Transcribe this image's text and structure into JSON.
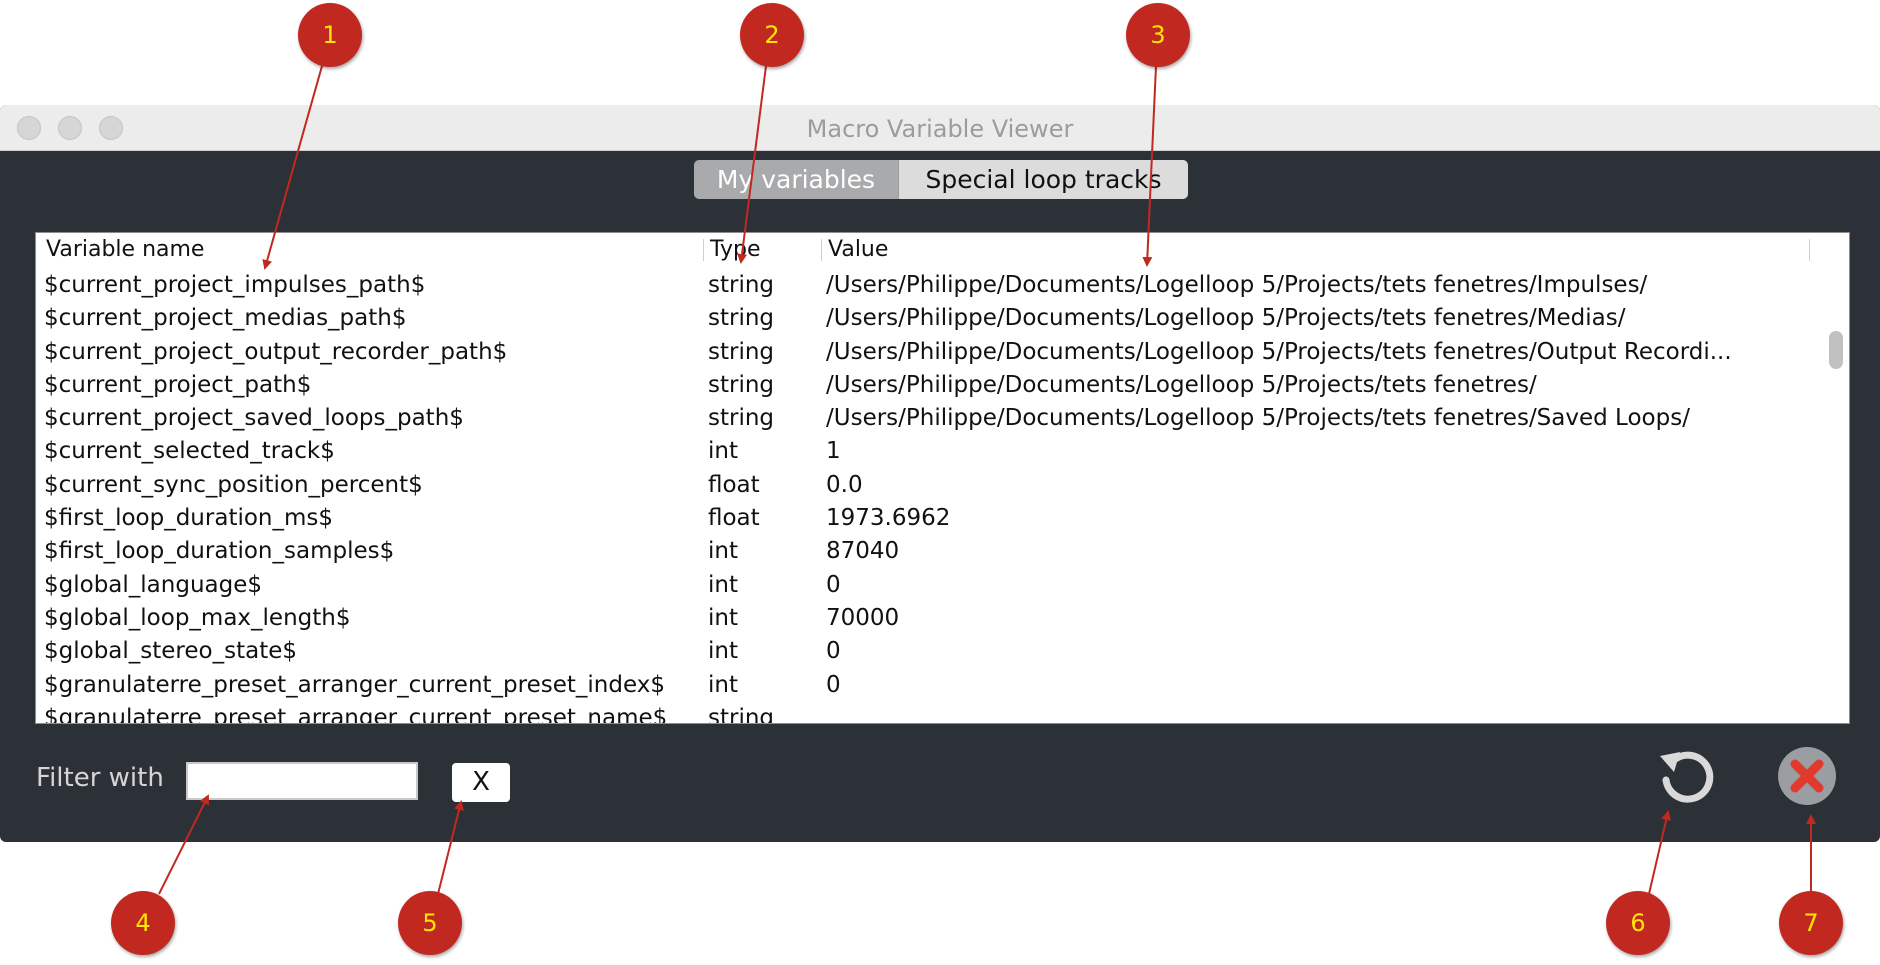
{
  "window": {
    "title": "Macro Variable Viewer",
    "controls": [
      "close",
      "minimize",
      "zoom"
    ]
  },
  "tabs": [
    {
      "label": "My variables",
      "active": true
    },
    {
      "label": "Special loop tracks",
      "active": false
    }
  ],
  "table": {
    "headers": {
      "name": "Variable name",
      "type": "Type",
      "value": "Value"
    },
    "rows": [
      {
        "name": "$current_project_impulses_path$",
        "type": "string",
        "value": "/Users/Philippe/Documents/Logelloop 5/Projects/tets fenetres/Impulses/"
      },
      {
        "name": "$current_project_medias_path$",
        "type": "string",
        "value": "/Users/Philippe/Documents/Logelloop 5/Projects/tets fenetres/Medias/"
      },
      {
        "name": "$current_project_output_recorder_path$",
        "type": "string",
        "value": "/Users/Philippe/Documents/Logelloop 5/Projects/tets fenetres/Output Recordi..."
      },
      {
        "name": "$current_project_path$",
        "type": "string",
        "value": "/Users/Philippe/Documents/Logelloop 5/Projects/tets fenetres/"
      },
      {
        "name": "$current_project_saved_loops_path$",
        "type": "string",
        "value": "/Users/Philippe/Documents/Logelloop 5/Projects/tets fenetres/Saved Loops/"
      },
      {
        "name": "$current_selected_track$",
        "type": "int",
        "value": "1"
      },
      {
        "name": "$current_sync_position_percent$",
        "type": "float",
        "value": "0.0"
      },
      {
        "name": "$first_loop_duration_ms$",
        "type": "float",
        "value": "1973.6962"
      },
      {
        "name": "$first_loop_duration_samples$",
        "type": "int",
        "value": "87040"
      },
      {
        "name": "$global_language$",
        "type": "int",
        "value": "0"
      },
      {
        "name": "$global_loop_max_length$",
        "type": "int",
        "value": "70000"
      },
      {
        "name": "$global_stereo_state$",
        "type": "int",
        "value": "0"
      },
      {
        "name": "$granulaterre_preset_arranger_current_preset_index$",
        "type": "int",
        "value": "0"
      },
      {
        "name": "$granulaterre_preset_arranger_current_preset_name$",
        "type": "string",
        "value": ""
      }
    ]
  },
  "filter": {
    "label": "Filter with",
    "value": "",
    "placeholder": "",
    "clear_label": "X"
  },
  "actions": {
    "refresh_icon": "refresh-icon",
    "close_icon": "close-x-icon"
  },
  "callouts": [
    "1",
    "2",
    "3",
    "4",
    "5",
    "6",
    "7"
  ],
  "colors": {
    "window_bg": "#2c3138",
    "callout_fill": "#c12820",
    "callout_text": "#ffe700",
    "arrow": "#c12820",
    "close_x": "#e03a2c"
  }
}
